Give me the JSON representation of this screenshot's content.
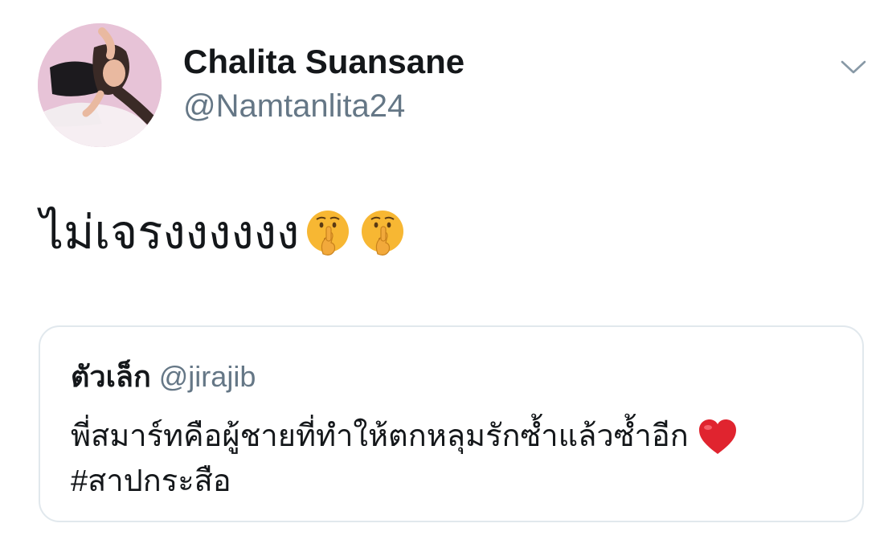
{
  "author": {
    "display_name": "Chalita Suansane",
    "handle": "@Namtanlita24",
    "avatar_icon": "profile-photo"
  },
  "menu": {
    "icon": "chevron-down-icon"
  },
  "tweet": {
    "text": "ไม่เจรงงงงงง",
    "emojis": [
      "shushing-face-emoji",
      "shushing-face-emoji"
    ]
  },
  "quoted_tweet": {
    "name": "ตัวเล็ก",
    "handle": "@jirajib",
    "line1": "พี่สมาร์ทคือผู้ชายที่ทำให้ตกหลุมรักซ้ำแล้วซ้ำอีก",
    "line2": "#สาปกระสือ",
    "emoji": "red-heart-emoji"
  },
  "colors": {
    "text": "#14171a",
    "secondary": "#657786",
    "border": "#e1e8ed",
    "heart": "#e0242f",
    "emoji_yellow": "#f7b733"
  }
}
